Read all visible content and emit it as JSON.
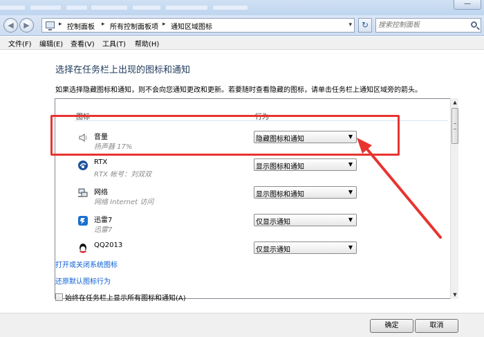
{
  "window": {
    "minimize_glyph": "—"
  },
  "address": {
    "crumbs": [
      "控制面板",
      "所有控制面板项",
      "通知区域图标"
    ],
    "search_placeholder": "搜索控制面板"
  },
  "menu": [
    "文件(F)",
    "编辑(E)",
    "查看(V)",
    "工具(T)",
    "帮助(H)"
  ],
  "main": {
    "heading": "选择在任务栏上出现的图标和通知",
    "description": "如果选择隐藏图标和通知，则不会向您通知更改和更新。若要随时查看隐藏的图标，请单击任务栏上通知区域旁的箭头。",
    "columns": {
      "icon": "图标",
      "behavior": "行为"
    },
    "rows": [
      {
        "name": "音量",
        "sub": "扬声器 17%",
        "behavior": "隐藏图标和通知",
        "icon": "speaker-icon"
      },
      {
        "name": "RTX",
        "sub": "RTX 帐号：刘双双",
        "behavior": "显示图标和通知",
        "icon": "rtx-icon"
      },
      {
        "name": "网络",
        "sub": "网络 Internet 访问",
        "behavior": "显示图标和通知",
        "icon": "network-icon"
      },
      {
        "name": "迅雷7",
        "sub": "迅雷7",
        "behavior": "仅显示通知",
        "icon": "xunlei-icon"
      },
      {
        "name": "QQ2013",
        "sub": "",
        "behavior": "仅显示通知",
        "icon": "qq-icon"
      }
    ],
    "link_system_icons": "打开或关闭系统图标",
    "link_restore": "还原默认图标行为",
    "always_show_label": "始终在任务栏上显示所有图标和通知(A)",
    "always_show_checked": false
  },
  "footer": {
    "ok": "确定",
    "cancel": "取消"
  },
  "colors": {
    "annotation": "#e8332f",
    "link": "#0b5ed7",
    "heading": "#1e395b"
  }
}
